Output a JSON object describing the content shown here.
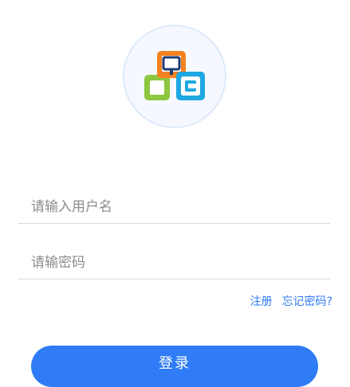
{
  "logo": {
    "icon": "app-logo",
    "colors": {
      "ring": "#dbe9fb",
      "fill": "#f5f9ff",
      "orange": "#f58220",
      "green": "#8dc63f",
      "blue": "#1ea7e1"
    }
  },
  "form": {
    "username_placeholder": "请输入用户名",
    "password_placeholder": "请输密码",
    "register_label": "注册",
    "forgot_label": "忘记密码?",
    "login_label": "登录"
  },
  "theme": {
    "accent": "#2f7cf6",
    "divider": "#d9d9d9",
    "placeholder_color": "#8c8c8c"
  }
}
